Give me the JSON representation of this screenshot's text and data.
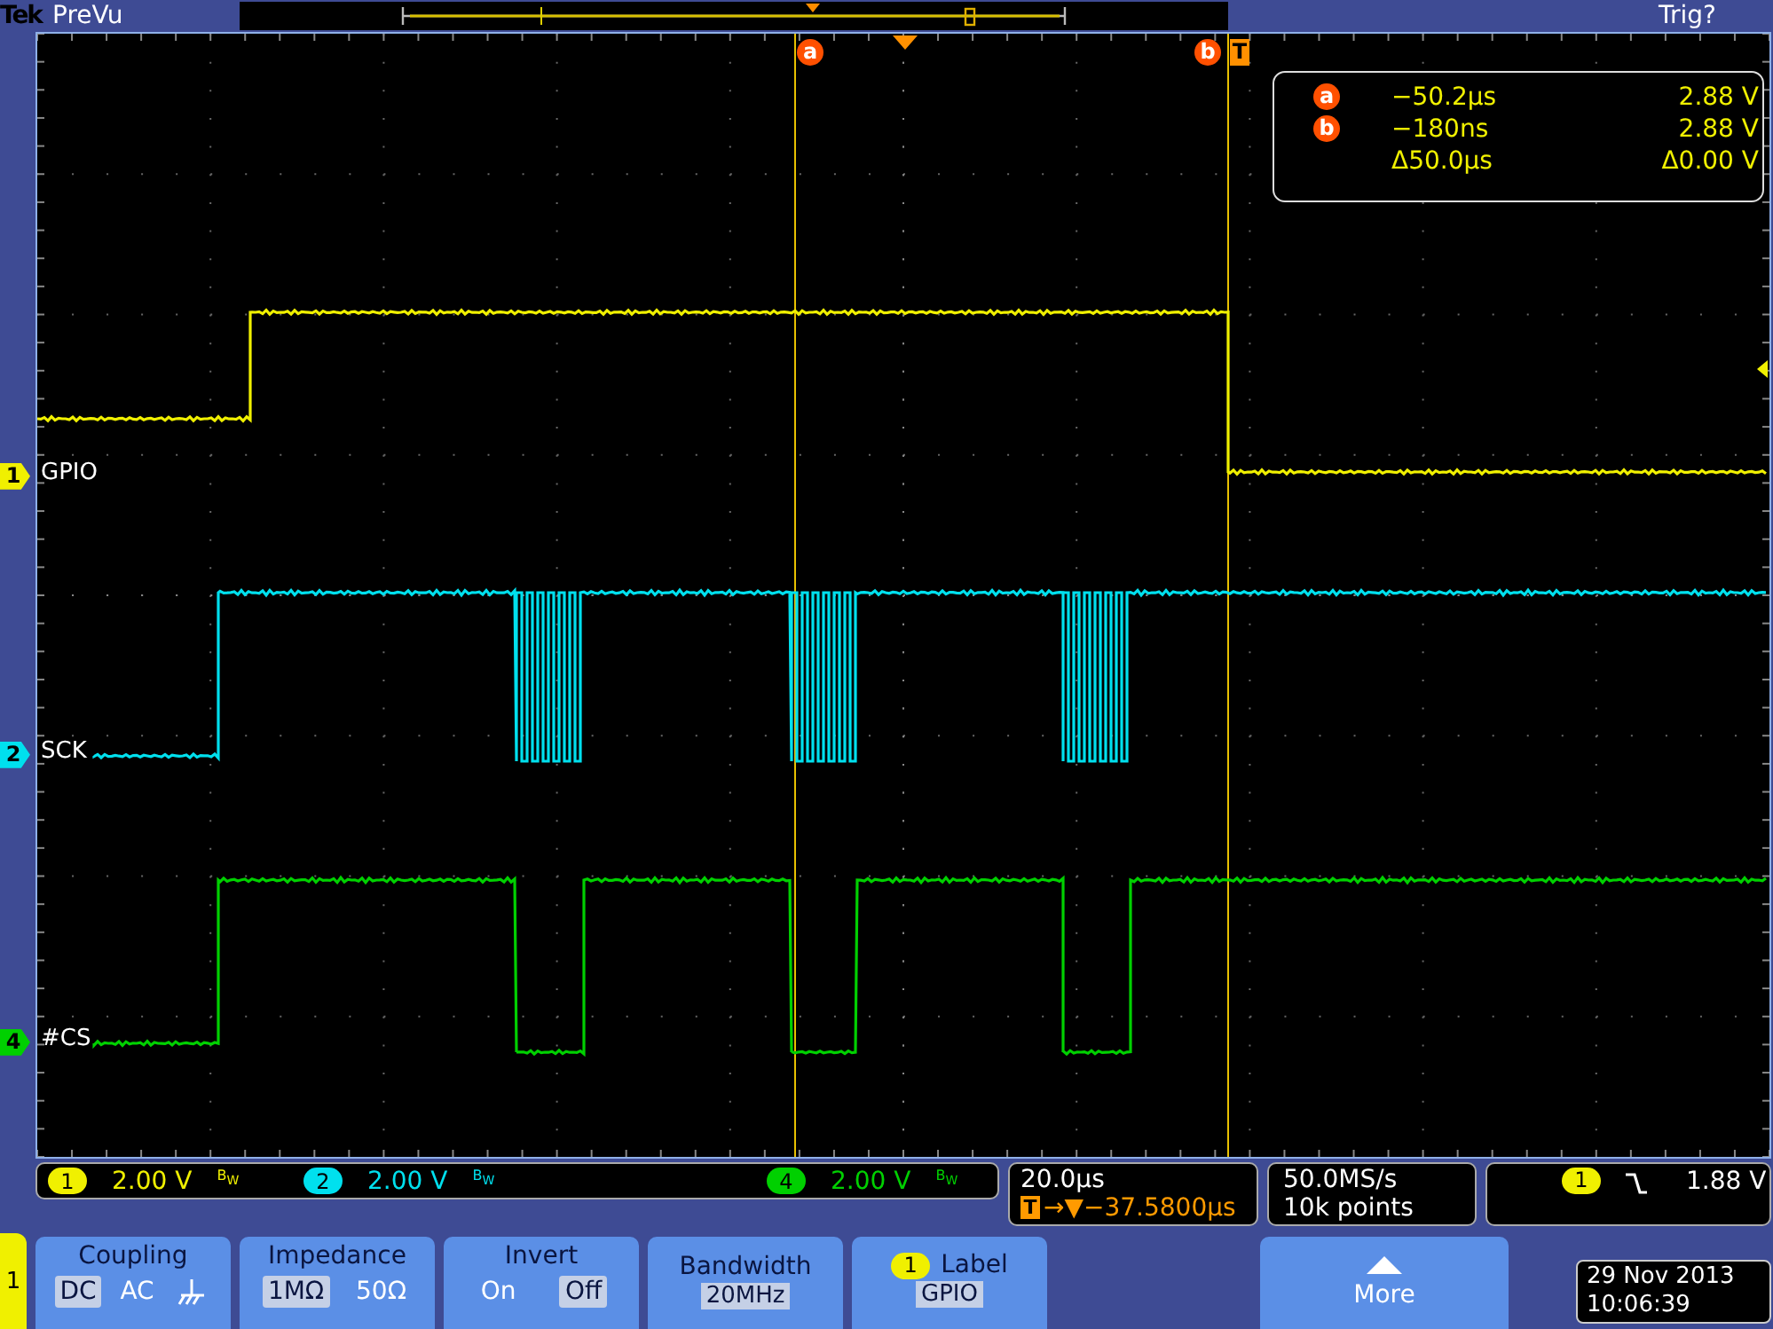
{
  "top_bar": {
    "brand": "Tek",
    "mode": "PreVu",
    "trigger_status": "Trig?"
  },
  "graticule": {
    "cursors": [
      {
        "label": "a"
      },
      {
        "label": "b"
      }
    ],
    "trigger_label": "T",
    "traces": [
      {
        "number": "1",
        "label": "GPIO",
        "color": "#f0f000"
      },
      {
        "number": "2",
        "label": "SCK",
        "color": "#00e0ee"
      },
      {
        "number": "4",
        "label": "#CS",
        "color": "#00d000"
      }
    ],
    "readout": [
      {
        "marker": "a",
        "time": "−50.2µs",
        "volts": "2.88 V"
      },
      {
        "marker": "b",
        "time": "−180ns",
        "volts": "2.88 V"
      },
      {
        "time": "Δ50.0µs",
        "volts": "Δ0.00 V"
      }
    ]
  },
  "status": {
    "channels": [
      {
        "number": "1",
        "scale": "2.00 V",
        "bandwidth": "B$_{W}$",
        "color": "#f0f000"
      },
      {
        "number": "2",
        "scale": "2.00 V",
        "bandwidth": "B$_{W}$",
        "color": "#00e0ee"
      },
      {
        "number": "4",
        "scale": "2.00 V",
        "bandwidth": "B$_{W}$",
        "color": "#00d000"
      }
    ],
    "timebase": {
      "scale": "20.0µs",
      "trigger_mark": "T",
      "delay": "→▼−37.5800µs"
    },
    "acquisition": {
      "rate": "50.0MS/s",
      "points": "10k points"
    },
    "trigger": {
      "source": "1",
      "level": "1.88 V"
    }
  },
  "menu": {
    "channel": "1",
    "buttons": [
      {
        "kind": "options",
        "title": "Coupling",
        "options": [
          {
            "kind": "text",
            "text": "DC",
            "selected": true
          },
          {
            "kind": "text",
            "text": "AC",
            "selected": false
          },
          {
            "kind": "ground",
            "selected": false
          }
        ]
      },
      {
        "kind": "options",
        "title": "Impedance",
        "options": [
          {
            "kind": "text",
            "text": "1MΩ",
            "selected": true
          },
          {
            "kind": "text",
            "text": "50Ω",
            "selected": false
          }
        ]
      },
      {
        "kind": "options",
        "title": "Invert",
        "options": [
          {
            "kind": "text",
            "text": "On",
            "selected": false
          },
          {
            "kind": "text",
            "text": "Off",
            "selected": true
          }
        ]
      },
      {
        "kind": "value",
        "title": "Bandwidth",
        "value": "20MHz"
      },
      {
        "kind": "label",
        "badge": "1",
        "title": "Label",
        "value": "GPIO"
      },
      {
        "kind": "more",
        "title": "More"
      }
    ],
    "date": "29 Nov 2013",
    "time": "10:06:39"
  }
}
